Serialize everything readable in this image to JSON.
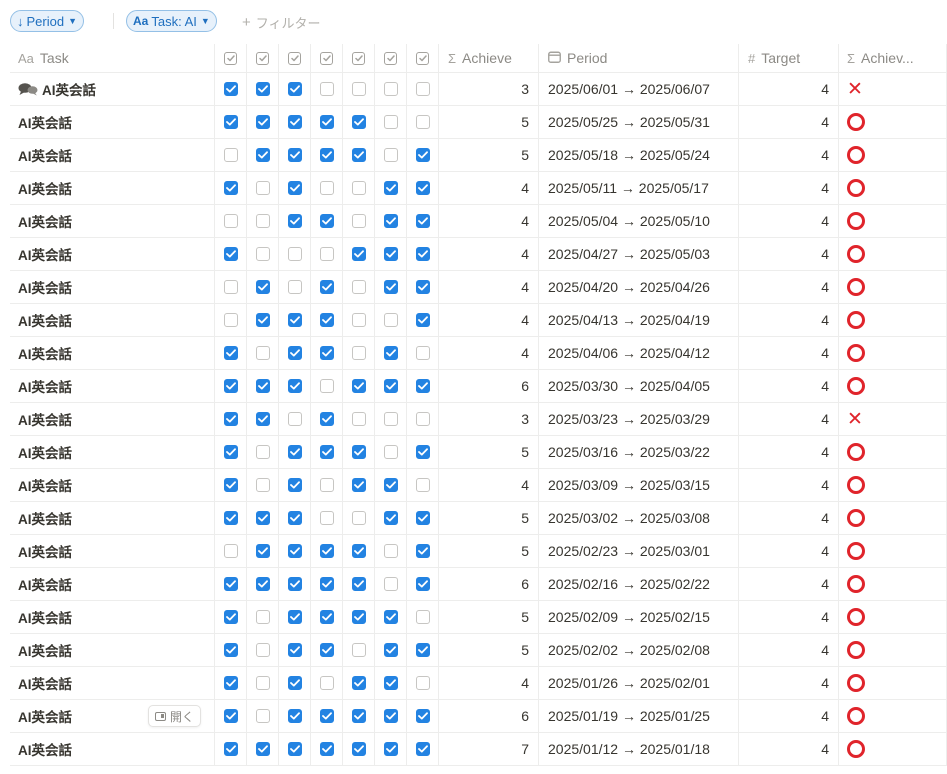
{
  "toolbar": {
    "sort_chip": {
      "label": "Period"
    },
    "filter_chip": {
      "label": "Task: AI"
    },
    "add_filter": {
      "label": "フィルター"
    }
  },
  "columns": {
    "task": {
      "label": "Task",
      "icon": "Aa"
    },
    "achieve": {
      "label": "Achieve",
      "icon": "Σ"
    },
    "period": {
      "label": "Period"
    },
    "target": {
      "label": "Target",
      "icon": "#"
    },
    "result": {
      "label": "Achiev...",
      "icon": "Σ"
    }
  },
  "open_button": {
    "label": "開く"
  },
  "colors": {
    "accent": "#2383e2",
    "fail_mark": "#e0242b",
    "chip_bg": "#e7f1fb"
  },
  "rows": [
    {
      "task": "AI英会話",
      "checks": [
        true,
        true,
        true,
        false,
        false,
        false,
        false
      ],
      "achieve": "3",
      "period": "2025/06/01 → 2025/06/07",
      "target": "4",
      "result": "x",
      "has_icon": true
    },
    {
      "task": "AI英会話",
      "checks": [
        true,
        true,
        true,
        true,
        true,
        false,
        false
      ],
      "achieve": "5",
      "period": "2025/05/25 → 2025/05/31",
      "target": "4",
      "result": "o"
    },
    {
      "task": "AI英会話",
      "checks": [
        false,
        true,
        true,
        true,
        true,
        false,
        true
      ],
      "achieve": "5",
      "period": "2025/05/18 → 2025/05/24",
      "target": "4",
      "result": "o"
    },
    {
      "task": "AI英会話",
      "checks": [
        true,
        false,
        true,
        false,
        false,
        true,
        true
      ],
      "achieve": "4",
      "period": "2025/05/11 → 2025/05/17",
      "target": "4",
      "result": "o"
    },
    {
      "task": "AI英会話",
      "checks": [
        false,
        false,
        true,
        true,
        false,
        true,
        true
      ],
      "achieve": "4",
      "period": "2025/05/04 → 2025/05/10",
      "target": "4",
      "result": "o"
    },
    {
      "task": "AI英会話",
      "checks": [
        true,
        false,
        false,
        false,
        true,
        true,
        true
      ],
      "achieve": "4",
      "period": "2025/04/27 → 2025/05/03",
      "target": "4",
      "result": "o"
    },
    {
      "task": "AI英会話",
      "checks": [
        false,
        true,
        false,
        true,
        false,
        true,
        true
      ],
      "achieve": "4",
      "period": "2025/04/20 → 2025/04/26",
      "target": "4",
      "result": "o"
    },
    {
      "task": "AI英会話",
      "checks": [
        false,
        true,
        true,
        true,
        false,
        false,
        true
      ],
      "achieve": "4",
      "period": "2025/04/13 → 2025/04/19",
      "target": "4",
      "result": "o"
    },
    {
      "task": "AI英会話",
      "checks": [
        true,
        false,
        true,
        true,
        false,
        true,
        false
      ],
      "achieve": "4",
      "period": "2025/04/06 → 2025/04/12",
      "target": "4",
      "result": "o"
    },
    {
      "task": "AI英会話",
      "checks": [
        true,
        true,
        true,
        false,
        true,
        true,
        true
      ],
      "achieve": "6",
      "period": "2025/03/30 → 2025/04/05",
      "target": "4",
      "result": "o"
    },
    {
      "task": "AI英会話",
      "checks": [
        true,
        true,
        false,
        true,
        false,
        false,
        false
      ],
      "achieve": "3",
      "period": "2025/03/23 → 2025/03/29",
      "target": "4",
      "result": "x"
    },
    {
      "task": "AI英会話",
      "checks": [
        true,
        false,
        true,
        true,
        true,
        false,
        true
      ],
      "achieve": "5",
      "period": "2025/03/16 → 2025/03/22",
      "target": "4",
      "result": "o"
    },
    {
      "task": "AI英会話",
      "checks": [
        true,
        false,
        true,
        false,
        true,
        true,
        false
      ],
      "achieve": "4",
      "period": "2025/03/09 → 2025/03/15",
      "target": "4",
      "result": "o"
    },
    {
      "task": "AI英会話",
      "checks": [
        true,
        true,
        true,
        false,
        false,
        true,
        true
      ],
      "achieve": "5",
      "period": "2025/03/02 → 2025/03/08",
      "target": "4",
      "result": "o"
    },
    {
      "task": "AI英会話",
      "checks": [
        false,
        true,
        true,
        true,
        true,
        false,
        true
      ],
      "achieve": "5",
      "period": "2025/02/23 → 2025/03/01",
      "target": "4",
      "result": "o"
    },
    {
      "task": "AI英会話",
      "checks": [
        true,
        true,
        true,
        true,
        true,
        false,
        true
      ],
      "achieve": "6",
      "period": "2025/02/16 → 2025/02/22",
      "target": "4",
      "result": "o"
    },
    {
      "task": "AI英会話",
      "checks": [
        true,
        false,
        true,
        true,
        true,
        true,
        false
      ],
      "achieve": "5",
      "period": "2025/02/09 → 2025/02/15",
      "target": "4",
      "result": "o"
    },
    {
      "task": "AI英会話",
      "checks": [
        true,
        false,
        true,
        true,
        false,
        true,
        true
      ],
      "achieve": "5",
      "period": "2025/02/02 → 2025/02/08",
      "target": "4",
      "result": "o"
    },
    {
      "task": "AI英会話",
      "checks": [
        true,
        false,
        true,
        false,
        true,
        true,
        false
      ],
      "achieve": "4",
      "period": "2025/01/26 → 2025/02/01",
      "target": "4",
      "result": "o"
    },
    {
      "task": "AI英会話",
      "checks": [
        true,
        false,
        true,
        true,
        true,
        true,
        true
      ],
      "achieve": "6",
      "period": "2025/01/19 → 2025/01/25",
      "target": "4",
      "result": "o",
      "hovered": true
    },
    {
      "task": "AI英会話",
      "checks": [
        true,
        true,
        true,
        true,
        true,
        true,
        true
      ],
      "achieve": "7",
      "period": "2025/01/12 → 2025/01/18",
      "target": "4",
      "result": "o"
    }
  ]
}
